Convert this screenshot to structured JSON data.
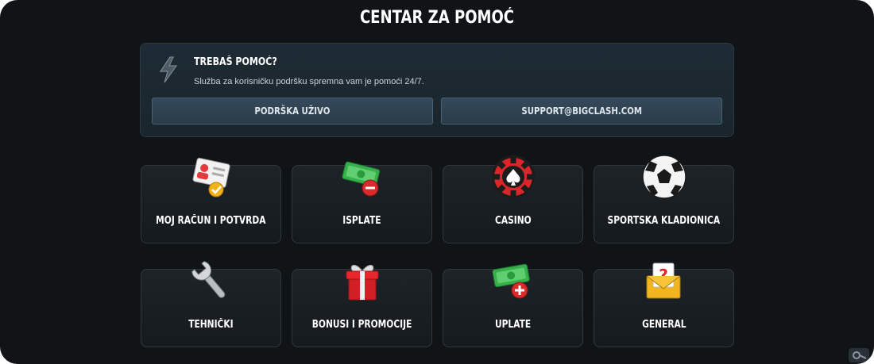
{
  "page": {
    "title": "CENTAR ZA POMOĆ"
  },
  "help": {
    "heading": "TREBAŠ POMOĆ?",
    "subtext": "Služba za korisničku podršku spremna vam je pomoći 24/7.",
    "live_button": "PODRŠKA UŽIVO",
    "email_button": "SUPPORT@BIGCLASH.COM"
  },
  "categories": [
    {
      "label": "MOJ RAČUN I POTVRDA",
      "icon": "id-card-check-icon"
    },
    {
      "label": "ISPLATE",
      "icon": "cash-minus-icon"
    },
    {
      "label": "CASINO",
      "icon": "poker-chip-icon"
    },
    {
      "label": "SPORTSKA KLADIONICA",
      "icon": "soccer-ball-icon"
    },
    {
      "label": "TEHNIČKI",
      "icon": "wrench-icon"
    },
    {
      "label": "BONUSI I PROMOCIJE",
      "icon": "gift-icon"
    },
    {
      "label": "UPLATE",
      "icon": "cash-plus-icon"
    },
    {
      "label": "GENERAL",
      "icon": "envelope-question-icon"
    }
  ],
  "colors": {
    "background": "#111416",
    "card": "#1f2b34",
    "button": "#34495a"
  }
}
